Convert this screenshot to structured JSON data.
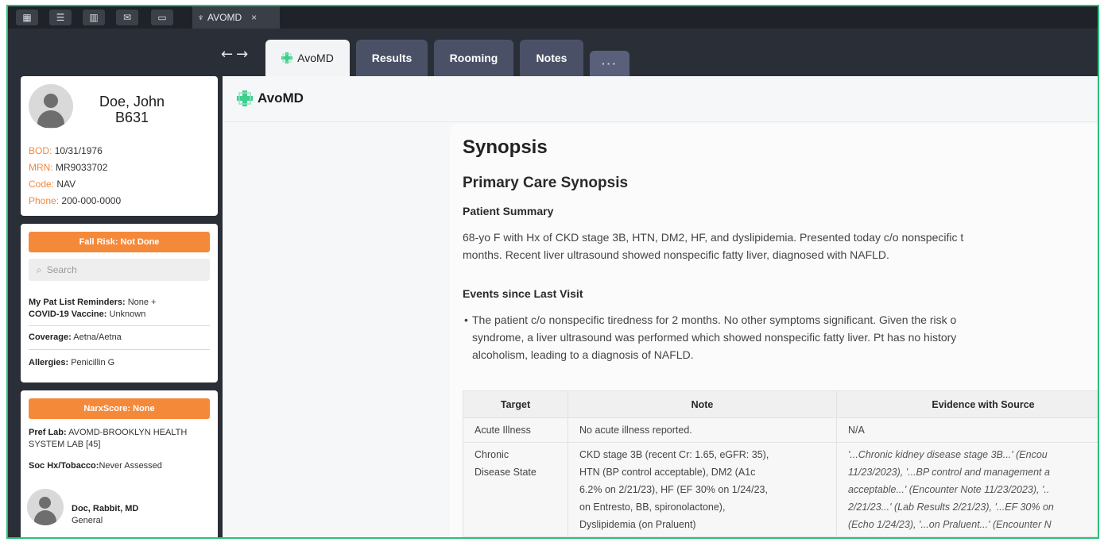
{
  "topbar": {
    "icons": [
      "calendar-icon",
      "list-icon",
      "grid-icon",
      "mail-icon",
      "chat-icon"
    ],
    "app_tab": {
      "label": "AVOMD",
      "close": "×"
    }
  },
  "nav": {
    "arrows": "←→",
    "tabs": [
      {
        "label": "AvoMD",
        "active": true
      },
      {
        "label": "Results",
        "active": false
      },
      {
        "label": "Rooming",
        "active": false
      },
      {
        "label": "Notes",
        "active": false
      },
      {
        "label": "···",
        "active": false
      }
    ]
  },
  "patient": {
    "name": "Doe, John",
    "id": "B631",
    "fields": [
      {
        "key": "BOD:",
        "value": "10/31/1976"
      },
      {
        "key": "MRN:",
        "value": "MR9033702"
      },
      {
        "key": "Code:",
        "value": "NAV"
      },
      {
        "key": "Phone:",
        "value": "200-000-0000"
      }
    ]
  },
  "risk": {
    "fall_risk": "Fall Risk: Not Done",
    "search_placeholder": "Search",
    "reminders_label": "My Pat List Reminders:",
    "reminders_value": "None +",
    "covid_label": "COVID-19 Vaccine:",
    "covid_value": "Unknown",
    "coverage_label": "Coverage:",
    "coverage_value": "Aetna/Aetna",
    "allergies_label": "Allergies:",
    "allergies_value": "Penicillin G"
  },
  "narx": {
    "score": "NarxScore: None",
    "pref_lab_label": "Pref Lab:",
    "pref_lab_value": "AVOMD-BROOKLYN HEALTH SYSTEM LAB [45]",
    "soc_label": "Soc Hx/Tobacco:",
    "soc_value": "Never Assessed",
    "doctor_name": "Doc, Rabbit, MD",
    "doctor_dept": "General"
  },
  "main": {
    "brand": "AvoMD",
    "title": "Synopsis",
    "subtitle": "Primary Care Synopsis",
    "summary_heading": "Patient Summary",
    "summary_lines": [
      "68-yo F with Hx of CKD stage 3B, HTN, DM2, HF, and dyslipidemia. Presented today c/o nonspecific t",
      "months. Recent liver ultrasound showed nonspecific fatty liver, diagnosed with NAFLD."
    ],
    "events_heading": "Events since Last Visit",
    "events_lines": [
      "The patient c/o nonspecific tiredness for 2 months. No other symptoms significant. Given the risk o",
      "syndrome, a liver ultrasound was performed which showed nonspecific fatty liver. Pt has no history",
      "alcoholism, leading to a diagnosis of NAFLD."
    ],
    "table": {
      "headers": [
        "Target",
        "Note",
        "Evidence with Source"
      ],
      "rows": [
        {
          "target": [
            "Acute Illness"
          ],
          "note": [
            "No acute illness reported."
          ],
          "evidence": [
            "N/A"
          ]
        },
        {
          "target": [
            "Chronic",
            "Disease State"
          ],
          "note": [
            "CKD stage 3B (recent Cr: 1.65, eGFR: 35),",
            "HTN (BP control acceptable), DM2 (A1c",
            "6.2% on 2/21/23), HF (EF 30% on 1/24/23,",
            "on Entresto, BB, spironolactone),",
            "Dyslipidemia (on Praluent)"
          ],
          "evidence": [
            "'...Chronic kidney disease stage 3B...' (Encou",
            "11/23/2023), '...BP control and management a",
            "acceptable...' (Encounter Note 11/23/2023), '..",
            "2/21/23...' (Lab Results 2/21/23), '...EF 30% on",
            "(Echo 1/24/23), '...on Praluent...' (Encounter N"
          ]
        }
      ]
    }
  }
}
